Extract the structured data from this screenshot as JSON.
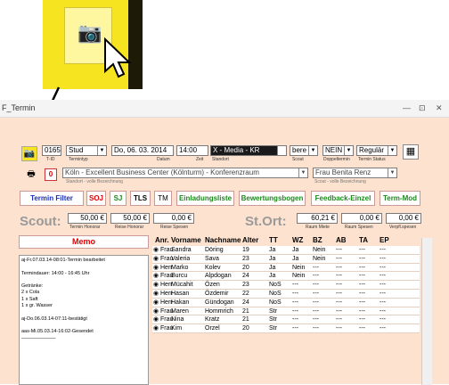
{
  "window": {
    "title": "F_Termin",
    "min": "—",
    "restore": "⊡",
    "close": "✕"
  },
  "toolbar": {
    "tid_value": "0165",
    "tid_label": "T-ID",
    "termintyp_value": "Stud",
    "termintyp_label": "Termintyp",
    "datum_value": "Do, 06. 03. 2014",
    "datum_label": "Datum",
    "zeit_value": "14:00",
    "zeit_label": "Zeit",
    "standort_value": "X - Media - KR",
    "standort_label": "Standort",
    "scout_value": "bere",
    "scout_label": "Scout",
    "doppel_value": "NEIN",
    "doppel_label": "Doppeltermin",
    "status_value": "Regulär",
    "status_label": "Termin Status"
  },
  "row2": {
    "location_value": "Köln - Excellent Business Center (Kölnturm) - Konferenzraum",
    "location_label": "Standort - volle Bezeichnung",
    "scout_full_value": "Frau Benita Renz",
    "scout_full_label": "Scout - volle Bezeichnung"
  },
  "buttons": {
    "termin_filter": "Termin Filter",
    "soj": "SOJ",
    "sj": "SJ",
    "tls": "TLS",
    "tm": "TM",
    "einladungsliste": "Einladungsliste",
    "bewertungsbogen": "Bewertungsbogen",
    "feedback": "Feedback-Einzel",
    "term_mod": "Term-Mod"
  },
  "costs": {
    "scout_label": "Scout:",
    "honorar_value": "50,00 €",
    "honorar_label": "Termin Honorar",
    "reise_value": "50,00 €",
    "reise_label": "Reise Honorar",
    "spesen_value": "0,00 €",
    "spesen_label": "Reise Spesen",
    "stort_label": "St.Ort:",
    "miete_value": "60,21 €",
    "miete_label": "Raum Miete",
    "raumsp_value": "0,00 €",
    "raumsp_label": "Raum Spesen",
    "verpf_value": "0,00 €",
    "verpf_label": "Verpfl.spesen"
  },
  "memo": {
    "label": "Memo",
    "text": "aj-Fr.07.03.14-08:01-Termin bearbeitet\n\nTermindauer: 14:00 - 16:45 Uhr\n\nGetränke:\n2 x Cola\n1 x Saft\n1 x gr. Wasser\n\naj-Do.06.03.14-07:11-bestätigt\n\naas-Mi.05.03.14-16:02-Gesendet\n———————"
  },
  "table": {
    "headers": [
      "Anr.",
      "Vorname",
      "Nachname",
      "Alter",
      "TT",
      "WZ",
      "BZ",
      "AB",
      "TA",
      "EP"
    ],
    "rows": [
      [
        "Frau",
        "Sandra",
        "Döring",
        "19",
        "Ja",
        "Ja",
        "Nein",
        "---",
        "---",
        "---"
      ],
      [
        "Frau",
        "Valeria",
        "Sava",
        "23",
        "Ja",
        "Ja",
        "Nein",
        "---",
        "---",
        "---"
      ],
      [
        "Herr",
        "Marko",
        "Kolev",
        "20",
        "Ja",
        "Nein",
        "---",
        "---",
        "---",
        "---"
      ],
      [
        "Frau",
        "Burcu",
        "Alpdogan",
        "24",
        "Ja",
        "Nein",
        "---",
        "---",
        "---",
        "---"
      ],
      [
        "Herr",
        "Mücahit",
        "Özen",
        "23",
        "NoS",
        "---",
        "---",
        "---",
        "---",
        "---"
      ],
      [
        "Herr",
        "Hasan",
        "Özdemir",
        "22",
        "NoS",
        "---",
        "---",
        "---",
        "---",
        "---"
      ],
      [
        "Herr",
        "Hakan",
        "Gündogan",
        "24",
        "NoS",
        "---",
        "---",
        "---",
        "---",
        "---"
      ],
      [
        "Frau",
        "Maren",
        "Hommrich",
        "21",
        "Str",
        "---",
        "---",
        "---",
        "---",
        "---"
      ],
      [
        "Frau",
        "Nina",
        "Kratz",
        "21",
        "Str",
        "---",
        "---",
        "---",
        "---",
        "---"
      ],
      [
        "Frau",
        "Kim",
        "Orzel",
        "20",
        "Str",
        "---",
        "---",
        "---",
        "---",
        "---"
      ]
    ]
  },
  "icons": {
    "camera": "📷",
    "print": "🖶",
    "zero": "0",
    "grid": "▦",
    "radio": "◉"
  }
}
